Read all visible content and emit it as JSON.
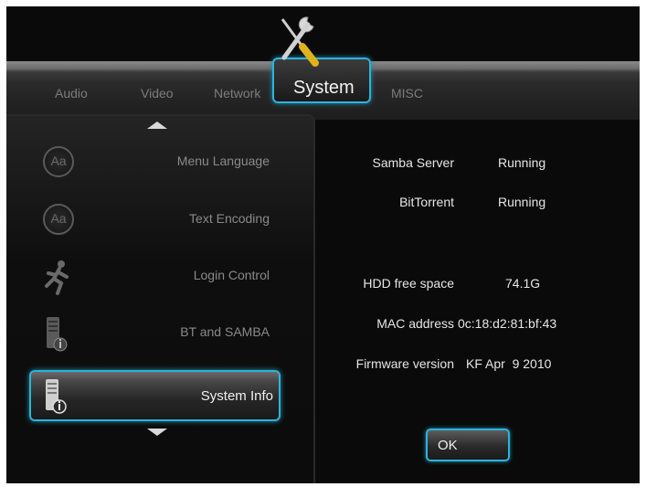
{
  "tabs": [
    "Audio",
    "Video",
    "Network",
    "System",
    "MISC"
  ],
  "active_tab": "System",
  "menu": [
    {
      "label": "Menu Language",
      "icon": "language-icon"
    },
    {
      "label": "Text Encoding",
      "icon": "text-encoding-icon"
    },
    {
      "label": "Login Control",
      "icon": "running-man-icon"
    },
    {
      "label": "BT and SAMBA",
      "icon": "server-info-icon"
    },
    {
      "label": "System Info",
      "icon": "server-info-icon"
    }
  ],
  "selected_menu": "System Info",
  "info": {
    "samba_server_label": "Samba Server",
    "samba_server_value": "Running",
    "bittorrent_label": "BitTorrent",
    "bittorrent_value": "Running",
    "hdd_label": "HDD free space",
    "hdd_value": "74.1G",
    "mac_label": "MAC address",
    "mac_value": "0c:18:d2:81:bf:43",
    "firmware_label": "Firmware version",
    "firmware_value": "KF Apr  9 2010"
  },
  "ok_label": "OK",
  "accent_color": "#2fb2da"
}
